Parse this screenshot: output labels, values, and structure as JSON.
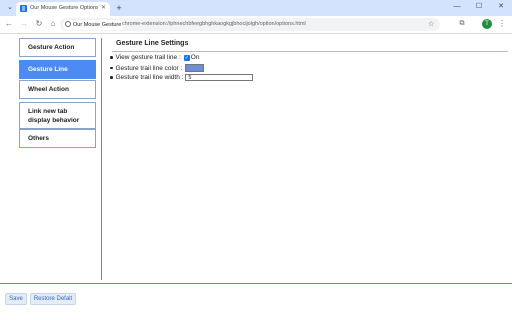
{
  "browser": {
    "tab_title": "Our Mouse Gesture Options Se",
    "tab_close": "✕",
    "new_tab": "+",
    "window_controls": [
      "—",
      "☐",
      "✕"
    ],
    "site_chip": "Our Mouse Gesture",
    "url": "chrome-extension://phnechbfeegbhghkaogkgjbhocijoigh/option/options.html",
    "profile_initial": "T"
  },
  "sidebar": {
    "items": [
      {
        "label": "Gesture Action",
        "active": false
      },
      {
        "label": "Gesture Line",
        "active": true
      },
      {
        "label": "Wheel Action",
        "active": false
      },
      {
        "label": "Link new tab display behavior",
        "active": false
      },
      {
        "label": "Others",
        "active": false
      }
    ]
  },
  "main": {
    "section_title": "Gesture Line Settings",
    "options": {
      "view_trail_label": "View gesture trail line :",
      "view_trail_value": "On",
      "view_trail_checked": true,
      "color_label": "Gesture trail line color :",
      "color_value": "#6d8fd6",
      "width_label": "Gesture trail line width :",
      "width_value": "5"
    }
  },
  "footer": {
    "save_label": "Save",
    "restore_label": "Restore Defalt"
  },
  "colors": {
    "accent": "#4c8bf5",
    "button_text": "#3768b5"
  }
}
